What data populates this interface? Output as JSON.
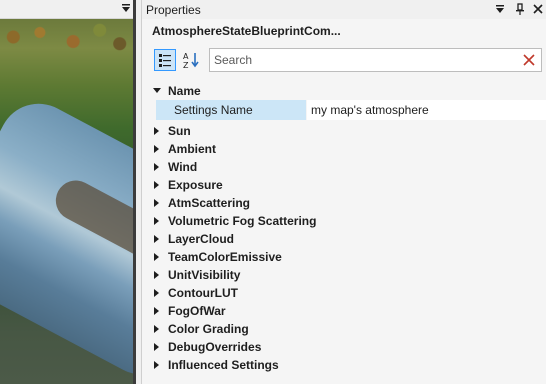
{
  "viewport": {
    "menu_icon": "dropdown-arrow-icon"
  },
  "properties_panel": {
    "title": "Properties",
    "titlebar_buttons": [
      "dropdown-arrow-icon",
      "pin-icon",
      "close-icon"
    ],
    "object_title": "AtmosphereStateBlueprintCom...",
    "search": {
      "placeholder": "Search",
      "value": ""
    },
    "expanded_category": {
      "label": "Name",
      "property": {
        "name": "Settings Name",
        "value": "my map's atmosphere"
      }
    },
    "categories": [
      "Sun",
      "Ambient",
      "Wind",
      "Exposure",
      "AtmScattering",
      "Volumetric Fog Scattering",
      "LayerCloud",
      "TeamColorEmissive",
      "UnitVisibility",
      "ContourLUT",
      "FogOfWar",
      "Color Grading",
      "DebugOverrides",
      "Influenced Settings"
    ]
  },
  "colors": {
    "accent": "#3399ff",
    "selected_row": "#cce6f7",
    "clear_icon": "#c0392b"
  }
}
